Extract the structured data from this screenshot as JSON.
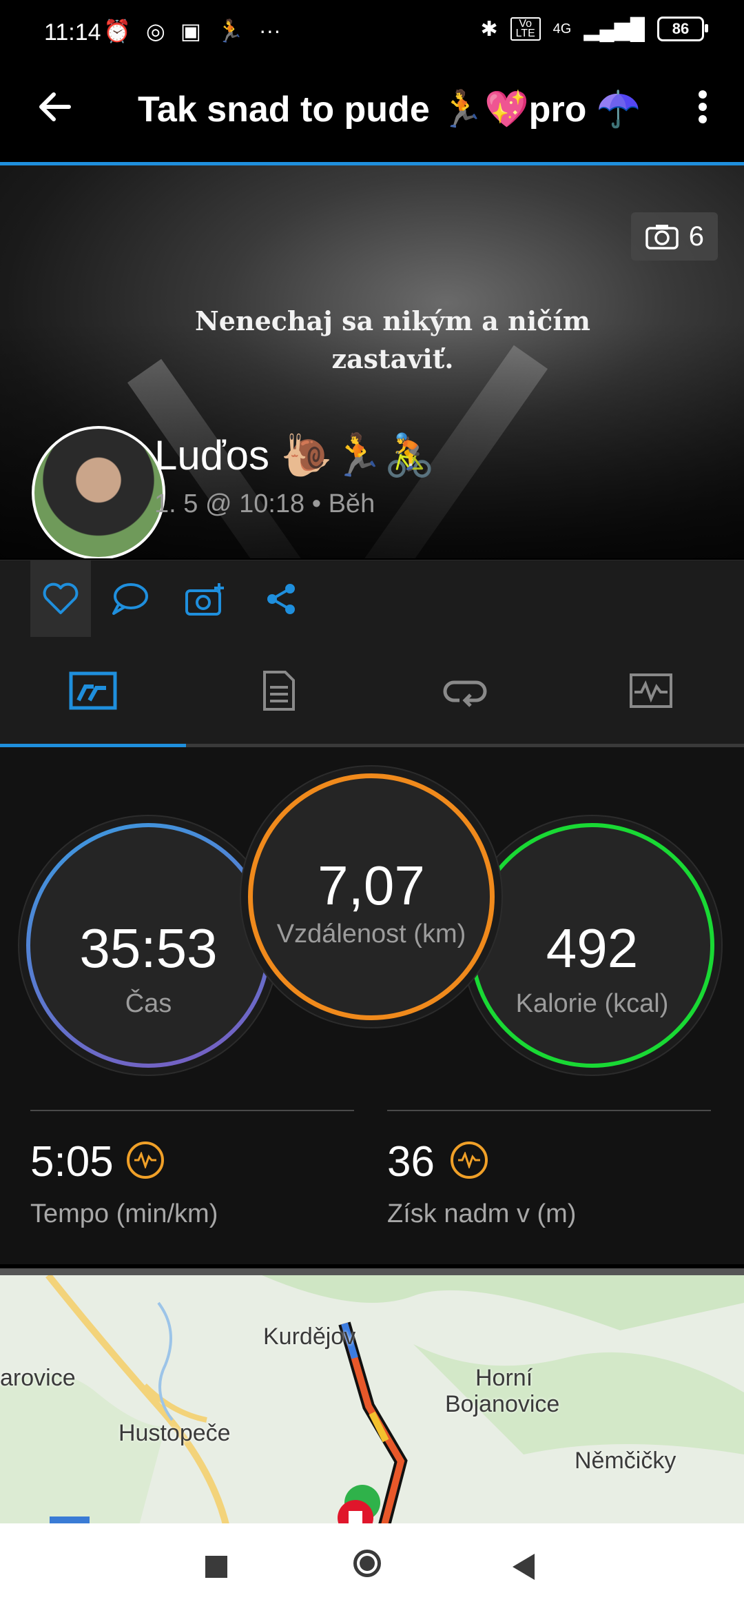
{
  "status_bar": {
    "time": "11:14",
    "network": "4G",
    "volte": "Vo LTE",
    "battery": "86"
  },
  "app_bar": {
    "title": "Tak snad to pude 🏃💖pro ☂️"
  },
  "hero": {
    "quote_line1": "Nenechaj sa nikým a ničím",
    "quote_line2": "zastaviť.",
    "photo_count": "6",
    "user_name": "Luďos 🐌🏃🚴",
    "activity_meta": "1. 5 @ 10:18 • Běh"
  },
  "tabs": [
    "summary",
    "details",
    "laps",
    "charts"
  ],
  "stats": {
    "time": {
      "value": "35:53",
      "label": "Čas"
    },
    "distance": {
      "value": "7,07",
      "label": "Vzdálenost (km)"
    },
    "calories": {
      "value": "492",
      "label": "Kalorie (kcal)"
    },
    "pace": {
      "value": "5:05",
      "label": "Tempo (min/km)"
    },
    "elevation": {
      "value": "36",
      "label": "Získ nadm v (m)"
    }
  },
  "map": {
    "places": [
      "Kurdějov",
      "arovice",
      "Horní",
      "Bojanovice",
      "Hustopeče",
      "Němčičky"
    ]
  },
  "colors": {
    "accent": "#1f8fdd",
    "distance_ring": "#f08a1c",
    "calories_ring": "#19d934",
    "pace_icon": "#f0a028"
  }
}
